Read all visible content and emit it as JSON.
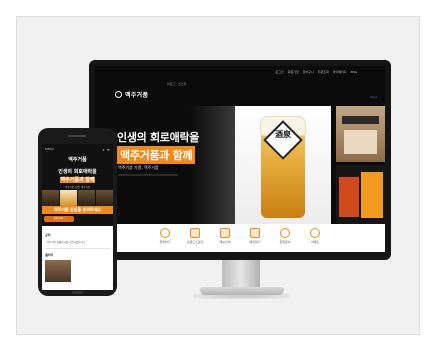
{
  "desktop": {
    "top_links": [
      "로그인",
      "회원가입",
      "장바구니",
      "주문조회",
      "마이페이지",
      "ENG"
    ],
    "mini_icons": [
      "블로그",
      "인스타"
    ],
    "logo_text": "맥주거품",
    "nav_hint": "Para",
    "headline_line1": "인생의 회로애락을",
    "headline_line2": "맥주거품과 함께",
    "subtitle": "맥주거품 가맹, 맥주거품",
    "glass_badge_text": "酒泉",
    "icon_bar": [
      {
        "icon": "beer-icon",
        "label": "창업하기"
      },
      {
        "icon": "store-icon",
        "label": "브랜드스토리"
      },
      {
        "icon": "menu-icon",
        "label": "메뉴안내"
      },
      {
        "icon": "map-icon",
        "label": "매장찾기"
      },
      {
        "icon": "notice-icon",
        "label": "창업문의"
      },
      {
        "icon": "event-icon",
        "label": "이벤트"
      }
    ]
  },
  "mobile": {
    "top_label": "MENU",
    "logo_text": "맥주거품",
    "headline_line1": "인생의 회로애락을",
    "headline_line2": "맥주거품과 함께",
    "subtitle": "맥주거품 가맹, 맥주거품",
    "orange_banner": "맥주거품 창업을 문의하세요",
    "pill_label": "창업문의 ›",
    "notice_title": "공지",
    "notice_line": "· 맥주거품 홈페이지를 오픈하였습니다",
    "section2_title": "갤러리"
  },
  "colors": {
    "accent": "#f28a1b",
    "dark": "#0b0b0b"
  }
}
